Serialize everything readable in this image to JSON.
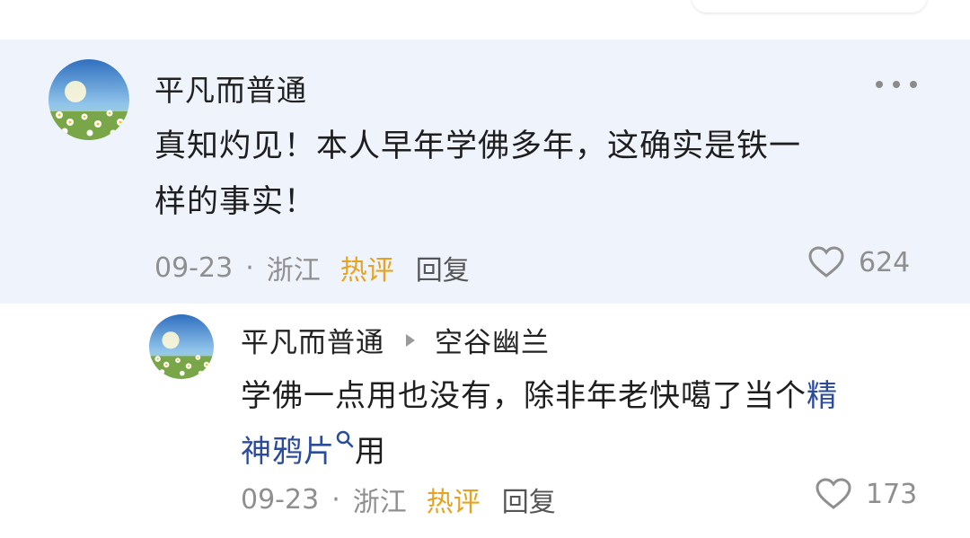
{
  "comment": {
    "author": "平凡而普通",
    "text_line1": "真知灼见！本人早年学佛多年，这确实是铁一",
    "text_line2": "样的事实！",
    "date": "09-23",
    "separator": "·",
    "location": "浙江",
    "hot_label": "热评",
    "reply_label": "回复",
    "likes": "624"
  },
  "reply": {
    "author": "平凡而普通",
    "reply_to": "空谷幽兰",
    "text_line1_prefix": "学佛一点用也没有，除非年老快噶了当个",
    "link_part1": "精",
    "link_part2": "神鸦片",
    "text_line2_suffix": "用",
    "date": "09-23",
    "separator": "·",
    "location": "浙江",
    "hot_label": "热评",
    "reply_label": "回复",
    "likes": "173"
  },
  "icons": {
    "more": "more-icon",
    "like": "heart-icon",
    "search": "search-icon",
    "arrow": "triangle-right-icon"
  },
  "colors": {
    "main_bg": "#eff3fb",
    "hot": "#e4a321",
    "link": "#2b4c9a",
    "meta": "#8f8f8f"
  }
}
